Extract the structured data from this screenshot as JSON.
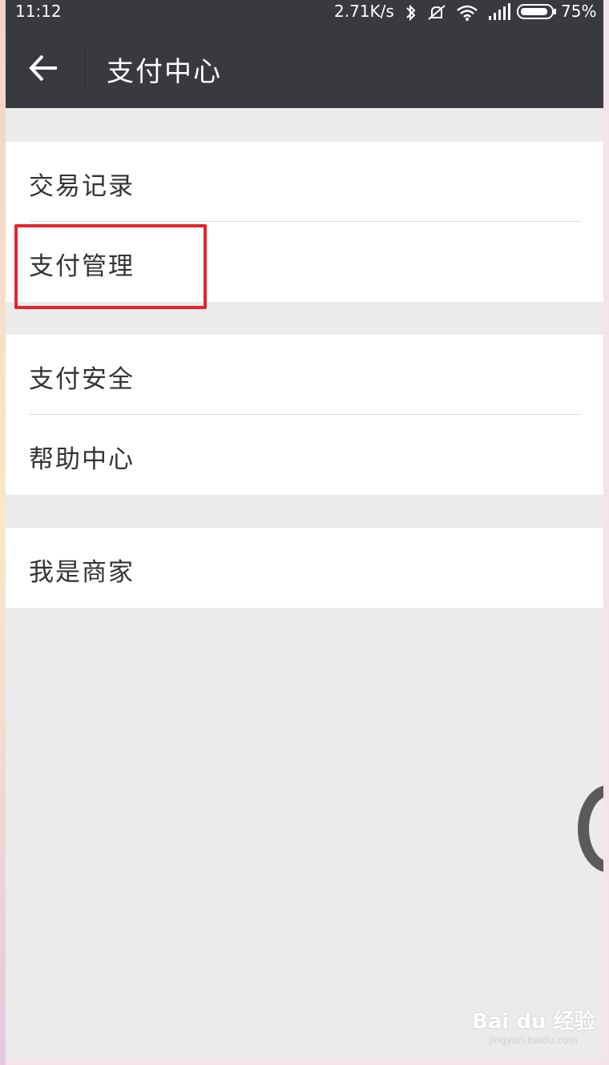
{
  "status_bar": {
    "time": "11:12",
    "net_speed": "2.71K/s",
    "battery": "75%"
  },
  "header": {
    "title": "支付中心"
  },
  "menu_groups": [
    [
      "交易记录",
      "支付管理"
    ],
    [
      "支付安全",
      "帮助中心"
    ],
    [
      "我是商家"
    ]
  ],
  "watermark": {
    "main": "Bai du 经验",
    "sub": "jingyan.baidu.com"
  },
  "colors": {
    "header_bg": "#383a40",
    "page_bg": "#ebebeb",
    "highlight": "#e0262b"
  }
}
